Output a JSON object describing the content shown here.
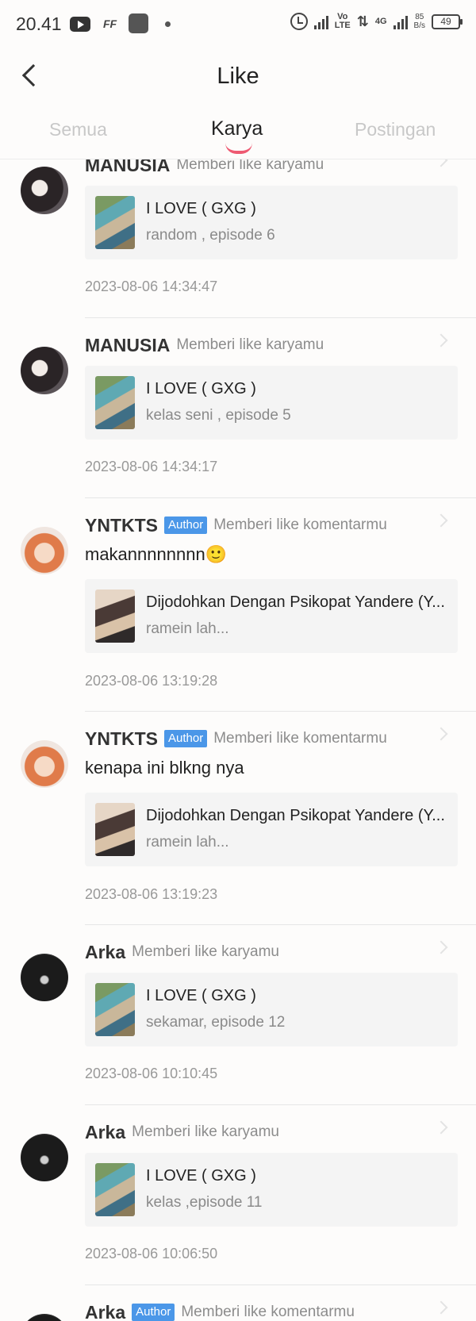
{
  "status_bar": {
    "time": "20.41",
    "app_icons": [
      "youtube-icon",
      "ff-icon",
      "app-square-icon",
      "dot-icon"
    ],
    "volte": "Vo\nLTE",
    "net_4g": "4G",
    "speed_value": "85",
    "speed_unit": "B/s",
    "battery": "49"
  },
  "header": {
    "title": "Like",
    "back_icon": "chevron-left-icon"
  },
  "tabs": [
    {
      "label": "Semua",
      "active": false
    },
    {
      "label": "Karya",
      "active": true
    },
    {
      "label": "Postingan",
      "active": false
    }
  ],
  "accent_color": "#ee5a72",
  "badge_color": "#4b97e8",
  "items": [
    {
      "user": "MANUSIA",
      "badge": "",
      "action": "Memberi like karyamu",
      "comment": "",
      "card_title": "I LOVE ( GXG )",
      "card_sub": "random , episode 6",
      "timestamp": "2023-08-06 14:34:47"
    },
    {
      "user": "MANUSIA",
      "badge": "",
      "action": "Memberi like karyamu",
      "comment": "",
      "card_title": "I LOVE ( GXG )",
      "card_sub": "kelas seni , episode 5",
      "timestamp": "2023-08-06 14:34:17"
    },
    {
      "user": "YNTKTS",
      "badge": "Author",
      "action": "Memberi like komentarmu",
      "comment": "makannnnnnnn🙂",
      "card_title": "Dijodohkan Dengan Psikopat Yandere (Y...",
      "card_sub": "ramein lah...",
      "timestamp": "2023-08-06 13:19:28"
    },
    {
      "user": "YNTKTS",
      "badge": "Author",
      "action": "Memberi like komentarmu",
      "comment": "kenapa ini blkng nya",
      "card_title": "Dijodohkan Dengan Psikopat Yandere (Y...",
      "card_sub": "ramein lah...",
      "timestamp": "2023-08-06 13:19:23"
    },
    {
      "user": "Arka",
      "badge": "",
      "action": "Memberi like karyamu",
      "comment": "",
      "card_title": "I LOVE ( GXG )",
      "card_sub": "sekamar, episode 12",
      "timestamp": "2023-08-06 10:10:45"
    },
    {
      "user": "Arka",
      "badge": "",
      "action": "Memberi like karyamu",
      "comment": "",
      "card_title": "I LOVE ( GXG )",
      "card_sub": "kelas ,episode 11",
      "timestamp": "2023-08-06 10:06:50"
    },
    {
      "user": "Arka",
      "badge": "Author",
      "action": "Memberi like komentarmu",
      "comment": "",
      "card_title": "",
      "card_sub": "",
      "timestamp": ""
    }
  ]
}
